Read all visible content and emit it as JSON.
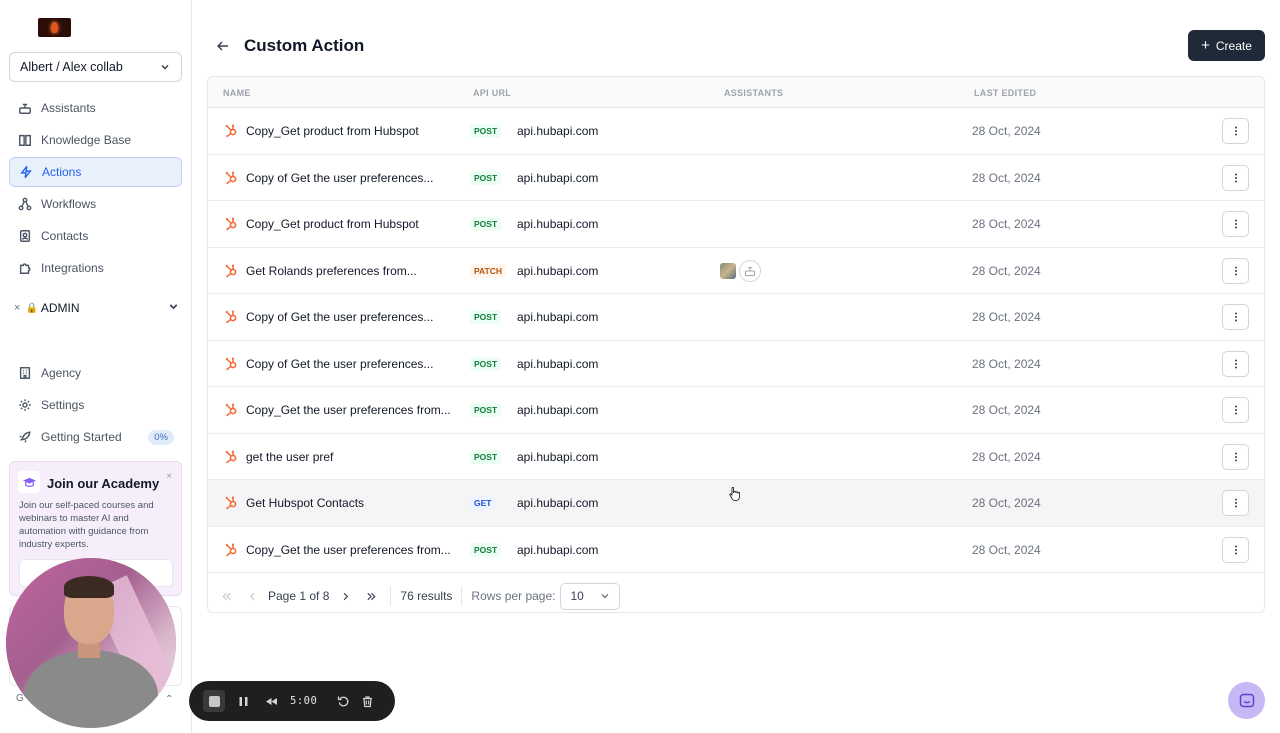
{
  "sidebar": {
    "workspace": "Albert / Alex collab",
    "items": [
      {
        "label": "Assistants",
        "icon": "assistant-icon"
      },
      {
        "label": "Knowledge Base",
        "icon": "book-icon"
      },
      {
        "label": "Actions",
        "icon": "bolt-icon",
        "active": true
      },
      {
        "label": "Workflows",
        "icon": "workflow-icon"
      },
      {
        "label": "Contacts",
        "icon": "contacts-icon"
      },
      {
        "label": "Integrations",
        "icon": "puzzle-icon"
      }
    ],
    "admin_label": "ADMIN",
    "admin_close": "×",
    "admin_lock": "🔒",
    "items2": [
      {
        "label": "Agency",
        "icon": "building-icon"
      },
      {
        "label": "Settings",
        "icon": "gear-icon"
      },
      {
        "label": "Getting Started",
        "icon": "rocket-icon",
        "badge": "0%"
      }
    ],
    "academy": {
      "title": "Join our Academy",
      "close": "×",
      "description": "Join our self-paced courses and webinars to master AI and automation with guidance from industry experts."
    },
    "footer_left": "G",
    "footer_right": "⌃"
  },
  "header": {
    "title": "Custom Action",
    "create_label": "Create"
  },
  "table": {
    "columns": [
      "NAME",
      "API URL",
      "ASSISTANTS",
      "LAST EDITED"
    ],
    "rows": [
      {
        "name": "Copy_Get product from Hubspot",
        "method": "POST",
        "url": "api.hubapi.com",
        "date": "28 Oct, 2024"
      },
      {
        "name": "Copy of Get the user preferences...",
        "method": "POST",
        "url": "api.hubapi.com",
        "date": "28 Oct, 2024"
      },
      {
        "name": "Copy_Get product from Hubspot",
        "method": "POST",
        "url": "api.hubapi.com",
        "date": "28 Oct, 2024"
      },
      {
        "name": "Get Rolands preferences from...",
        "method": "PATCH",
        "url": "api.hubapi.com",
        "date": "28 Oct, 2024",
        "assistants": true
      },
      {
        "name": "Copy of Get the user preferences...",
        "method": "POST",
        "url": "api.hubapi.com",
        "date": "28 Oct, 2024"
      },
      {
        "name": "Copy of Get the user preferences...",
        "method": "POST",
        "url": "api.hubapi.com",
        "date": "28 Oct, 2024"
      },
      {
        "name": "Copy_Get the user preferences from...",
        "method": "POST",
        "url": "api.hubapi.com",
        "date": "28 Oct, 2024"
      },
      {
        "name": "get the user pref",
        "method": "POST",
        "url": "api.hubapi.com",
        "date": "28 Oct, 2024"
      },
      {
        "name": "Get Hubspot Contacts",
        "method": "GET",
        "url": "api.hubapi.com",
        "date": "28 Oct, 2024",
        "hover": true
      },
      {
        "name": "Copy_Get the user preferences from...",
        "method": "POST",
        "url": "api.hubapi.com",
        "date": "28 Oct, 2024"
      }
    ]
  },
  "pagination": {
    "page_text": "Page 1 of 8",
    "results": "76 results",
    "rows_label": "Rows per page:",
    "rows_value": "10"
  },
  "recorder": {
    "time": "5:00"
  },
  "colors": {
    "accent": "#2563eb",
    "hubspot": "#f26b3a",
    "dark_button": "#1f2937",
    "academy_bg": "#f6effb"
  }
}
